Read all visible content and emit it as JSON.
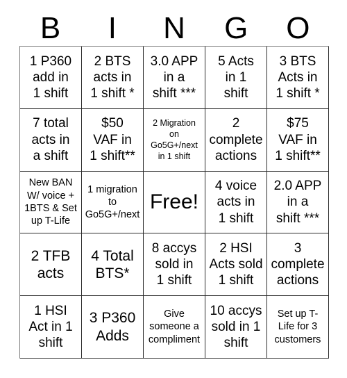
{
  "card": {
    "title_letters": [
      "B",
      "I",
      "N",
      "G",
      "O"
    ],
    "grid": {
      "rows": 5,
      "columns": 5,
      "cells": [
        {
          "text": "1 P360\nadd in\n1 shift",
          "size": "md"
        },
        {
          "text": "2 BTS\nacts in\n1 shift *",
          "size": "md"
        },
        {
          "text": "3.0 APP\nin a\nshift ***",
          "size": "md"
        },
        {
          "text": "5 Acts\nin 1\nshift",
          "size": "md"
        },
        {
          "text": "3 BTS\nActs in\n1 shift *",
          "size": "md"
        },
        {
          "text": "7 total\nacts in\na shift",
          "size": "md"
        },
        {
          "text": "$50\nVAF in\n1 shift**",
          "size": "md"
        },
        {
          "text": "2 Migration\non\nGo5G+/next\nin 1 shift",
          "size": "xs"
        },
        {
          "text": "2\ncomplete\nactions",
          "size": "md"
        },
        {
          "text": "$75\nVAF in\n1 shift**",
          "size": "md"
        },
        {
          "text": "New BAN\nW/ voice +\n1BTS & Set\nup T-Life",
          "size": "sm"
        },
        {
          "text": "1 migration\nto\nGo5G+/next",
          "size": "sm"
        },
        {
          "text": "Free!",
          "size": "xl"
        },
        {
          "text": "4 voice\nacts in\n1 shift",
          "size": "md"
        },
        {
          "text": "2.0 APP\nin a\nshift ***",
          "size": "md"
        },
        {
          "text": "2 TFB\nacts",
          "size": "lg"
        },
        {
          "text": "4 Total\nBTS*",
          "size": "lg"
        },
        {
          "text": "8 accys\nsold in\n1 shift",
          "size": "md"
        },
        {
          "text": "2 HSI\nActs sold\n1 shift",
          "size": "md"
        },
        {
          "text": "3\ncomplete\nactions",
          "size": "md"
        },
        {
          "text": "1 HSI\nAct in 1\nshift",
          "size": "md"
        },
        {
          "text": "3 P360\nAdds",
          "size": "lg"
        },
        {
          "text": "Give\nsomeone a\ncompliment",
          "size": "sm"
        },
        {
          "text": "10 accys\nsold in 1\nshift",
          "size": "md"
        },
        {
          "text": "Set up T-\nLife for 3\ncustomers",
          "size": "sm"
        }
      ]
    },
    "colors": {
      "background": "#ffffff",
      "text": "#000000",
      "border": "#2b2b2b",
      "outer_border": "#7a7a7a"
    }
  }
}
